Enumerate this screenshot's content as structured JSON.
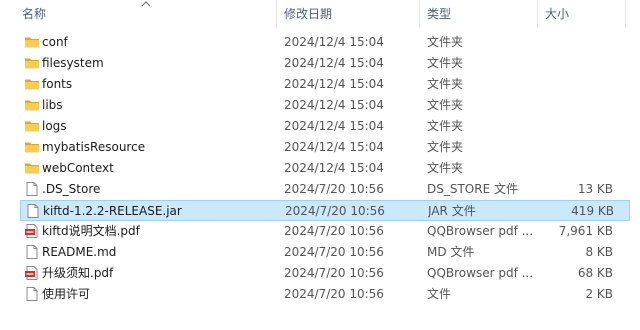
{
  "columns": {
    "name": "名称",
    "date": "修改日期",
    "type": "类型",
    "size": "大小"
  },
  "colors": {
    "folder": "#f4c347",
    "folder_dark": "#d9a521",
    "selected_bg": "#cce8ff",
    "pdf_red": "#d93025"
  },
  "rows": [
    {
      "icon": "folder-icon",
      "name": "conf",
      "date": "2024/12/4 15:04",
      "type": "文件夹",
      "size": ""
    },
    {
      "icon": "folder-icon",
      "name": "filesystem",
      "date": "2024/12/4 15:04",
      "type": "文件夹",
      "size": ""
    },
    {
      "icon": "folder-icon",
      "name": "fonts",
      "date": "2024/12/4 15:04",
      "type": "文件夹",
      "size": ""
    },
    {
      "icon": "folder-icon",
      "name": "libs",
      "date": "2024/12/4 15:04",
      "type": "文件夹",
      "size": ""
    },
    {
      "icon": "folder-icon",
      "name": "logs",
      "date": "2024/12/4 15:04",
      "type": "文件夹",
      "size": ""
    },
    {
      "icon": "folder-icon",
      "name": "mybatisResource",
      "date": "2024/12/4 15:04",
      "type": "文件夹",
      "size": ""
    },
    {
      "icon": "folder-icon",
      "name": "webContext",
      "date": "2024/12/4 15:04",
      "type": "文件夹",
      "size": ""
    },
    {
      "icon": "file-icon",
      "name": ".DS_Store",
      "date": "2024/7/20 10:56",
      "type": "DS_STORE 文件",
      "size": "13 KB"
    },
    {
      "icon": "file-icon",
      "name": "kiftd-1.2.2-RELEASE.jar",
      "date": "2024/7/20 10:56",
      "type": "JAR 文件",
      "size": "419 KB",
      "selected": true
    },
    {
      "icon": "pdf-icon",
      "name": "kiftd说明文档.pdf",
      "date": "2024/7/20 10:56",
      "type": "QQBrowser pdf ...",
      "size": "7,961 KB"
    },
    {
      "icon": "file-icon",
      "name": "README.md",
      "date": "2024/7/20 10:56",
      "type": "MD 文件",
      "size": "8 KB"
    },
    {
      "icon": "pdf-icon",
      "name": "升级须知.pdf",
      "date": "2024/7/20 10:56",
      "type": "QQBrowser pdf ...",
      "size": "68 KB"
    },
    {
      "icon": "file-icon",
      "name": "使用许可",
      "date": "2024/7/20 10:56",
      "type": "文件",
      "size": "2 KB"
    }
  ]
}
